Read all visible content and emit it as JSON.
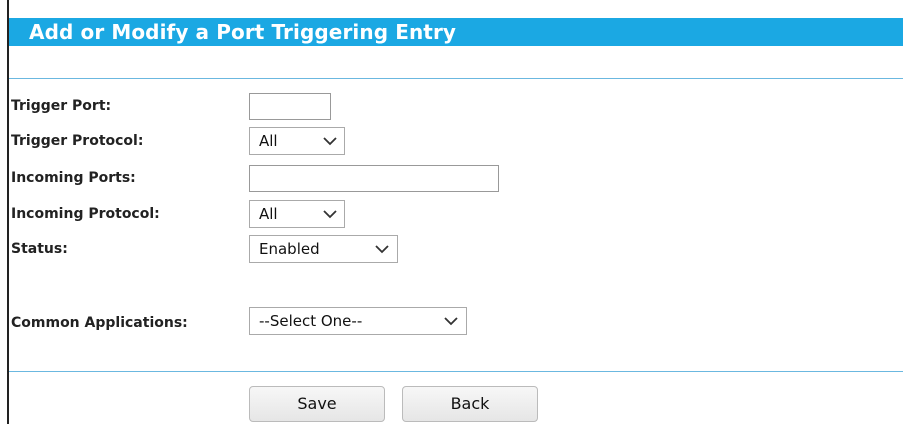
{
  "page": {
    "title": "Add or Modify a Port Triggering Entry"
  },
  "form": {
    "trigger_port": {
      "label": "Trigger Port:",
      "value": ""
    },
    "trigger_protocol": {
      "label": "Trigger Protocol:",
      "value": "All",
      "options": [
        "All"
      ]
    },
    "incoming_ports": {
      "label": "Incoming Ports:",
      "value": ""
    },
    "incoming_protocol": {
      "label": "Incoming Protocol:",
      "value": "All",
      "options": [
        "All"
      ]
    },
    "status": {
      "label": "Status:",
      "value": "Enabled",
      "options": [
        "Enabled"
      ]
    },
    "common_applications": {
      "label": "Common Applications:",
      "value": "--Select One--",
      "options": [
        "--Select One--"
      ]
    }
  },
  "buttons": {
    "save": "Save",
    "back": "Back"
  },
  "colors": {
    "title_bar": "#1ba8e3",
    "divider": "#6bb8e0"
  },
  "icons": {
    "dropdown": "chevron-down-icon"
  }
}
